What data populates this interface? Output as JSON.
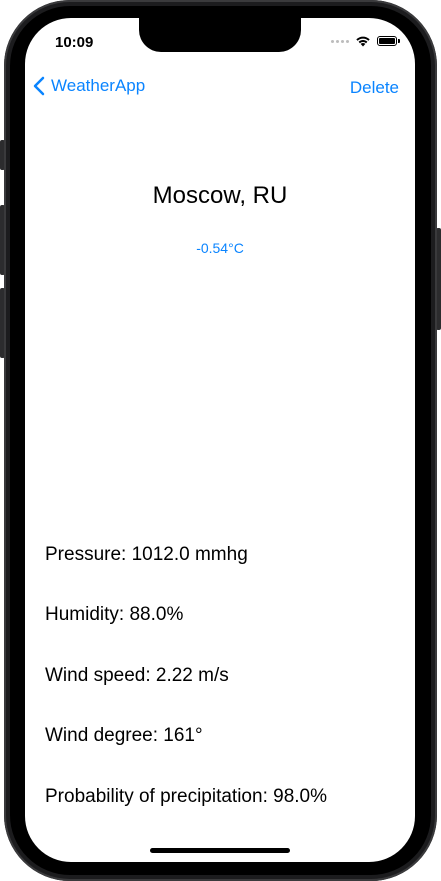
{
  "status_bar": {
    "time": "10:09"
  },
  "nav": {
    "back_label": "WeatherApp",
    "delete_label": "Delete"
  },
  "weather": {
    "city": "Moscow, RU",
    "temperature": "-0.54°C"
  },
  "details": [
    {
      "text": "Pressure: 1012.0 mmhg"
    },
    {
      "text": "Humidity: 88.0%"
    },
    {
      "text": "Wind speed: 2.22 m/s"
    },
    {
      "text": "Wind degree: 161°"
    },
    {
      "text": "Probability of precipitation: 98.0%"
    }
  ],
  "colors": {
    "accent": "#0a84ff",
    "text": "#000000",
    "background": "#ffffff"
  },
  "icons": [
    "chevron-left-icon",
    "signal-dots-icon",
    "wifi-icon",
    "battery-icon"
  ]
}
